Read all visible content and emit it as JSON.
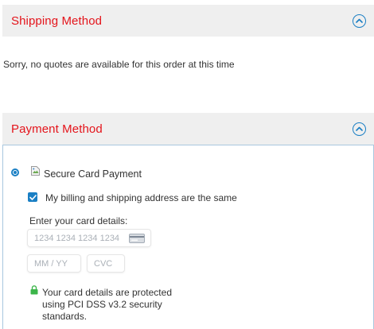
{
  "shipping": {
    "title": "Shipping Method",
    "message": "Sorry, no quotes are available for this order at this time"
  },
  "payment": {
    "title": "Payment Method",
    "method_label": "Secure Card Payment",
    "billing_same_label": "My billing and shipping address are the same",
    "billing_same_checked": true,
    "method_selected": true,
    "card_details_label": "Enter your card details:",
    "card_number_placeholder": "1234 1234 1234 1234",
    "expiry_placeholder": "MM / YY",
    "cvc_placeholder": "CVC",
    "secure_note": "Your card details are protected using PCI DSS v3.2 security standards."
  },
  "icons": {
    "collapse": "chevron-up-circle-icon",
    "card": "credit-card-icon",
    "lock": "lock-icon",
    "broken_image": "broken-image-icon"
  },
  "colors": {
    "accent": "#1a7fc4",
    "title_red": "#e4141b",
    "header_bg": "#efefef",
    "lock_green": "#3cb54a"
  }
}
